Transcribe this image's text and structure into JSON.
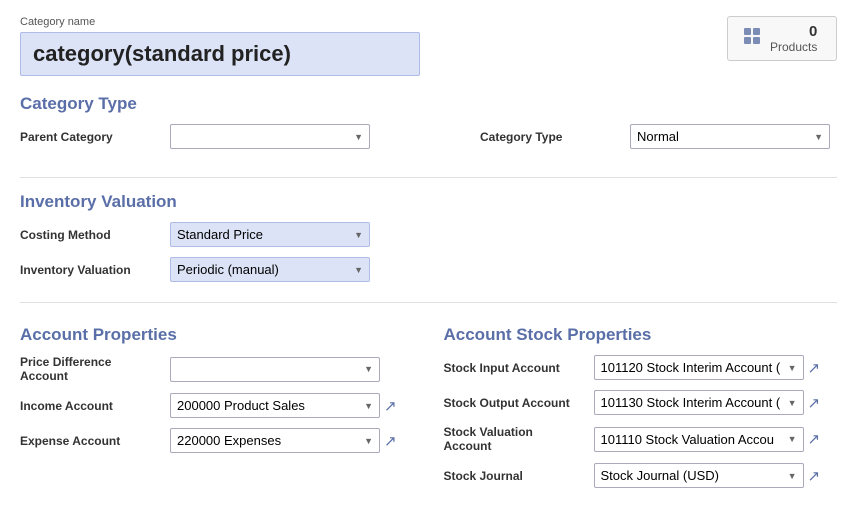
{
  "category_name_label": "Category name",
  "category_name_value": "category(standard price)",
  "products_count": "0",
  "products_label": "Products",
  "section_category_type": "Category Type",
  "section_inventory": "Inventory Valuation",
  "section_account": "Account Properties",
  "section_account_stock": "Account Stock Properties",
  "fields": {
    "parent_category_label": "Parent Category",
    "parent_category_placeholder": "",
    "category_type_label": "Category Type",
    "category_type_value": "Normal",
    "costing_method_label": "Costing Method",
    "costing_method_value": "Standard Price",
    "inventory_valuation_label": "Inventory Valuation",
    "inventory_valuation_value": "Periodic (manual)",
    "price_diff_account_label": "Price Difference Account",
    "income_account_label": "Income Account",
    "income_account_value": "200000 Product Sales",
    "expense_account_label": "Expense Account",
    "expense_account_value": "220000 Expenses",
    "stock_input_label": "Stock Input Account",
    "stock_input_value": "101120 Stock Interim Account (",
    "stock_output_label": "Stock Output Account",
    "stock_output_value": "101130 Stock Interim Account (",
    "stock_valuation_label": "Stock Valuation Account",
    "stock_valuation_value": "101110 Stock Valuation Accou",
    "stock_journal_label": "Stock Journal",
    "stock_journal_value": "Stock Journal (USD)"
  },
  "colors": {
    "accent": "#5a6fa8",
    "select_bg": "#dce3f7",
    "select_border": "#b0bce8"
  },
  "icons": {
    "external_link": "↗",
    "dropdown_arrow": "▼"
  }
}
